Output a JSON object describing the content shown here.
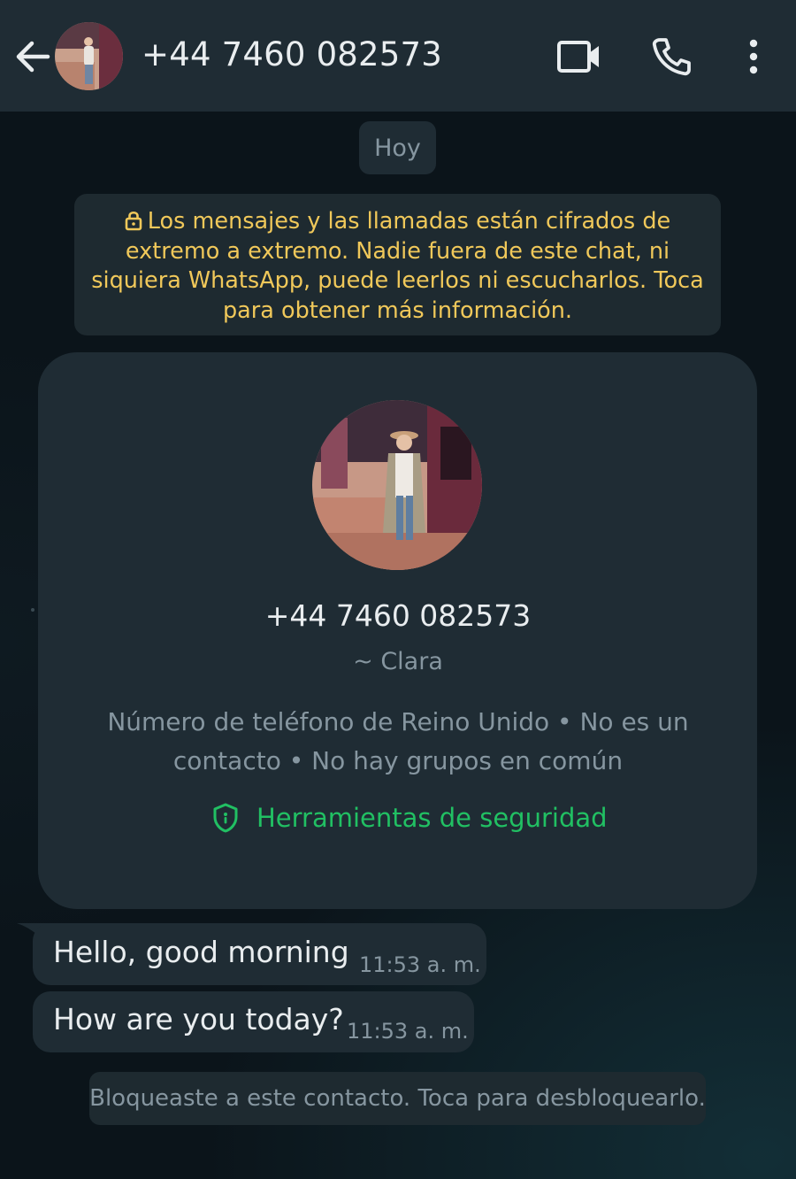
{
  "header": {
    "title": "+44 7460 082573",
    "back_icon": "arrow-left-icon",
    "video_icon": "video-camera-icon",
    "call_icon": "phone-icon",
    "more_icon": "more-vertical-icon"
  },
  "date_chip": "Hoy",
  "encryption_notice": {
    "icon": "lock-icon",
    "text": "Los mensajes y las llamadas están cifrados de extremo a extremo. Nadie fuera de este chat, ni siquiera WhatsApp, puede leerlos ni escucharlos. Toca para obtener más información."
  },
  "contact_card": {
    "phone": "+44 7460 082573",
    "name": "~ Clara",
    "info": "Número de teléfono de Reino Unido • No es un contacto • No hay grupos en común",
    "security_link": "Herramientas de seguridad",
    "security_icon": "shield-icon"
  },
  "messages": [
    {
      "text": "Hello, good morning",
      "time": "11:53 a. m."
    },
    {
      "text": "How are you today?",
      "time": "11:53 a. m."
    }
  ],
  "blocked_notice": "Bloqueaste a este contacto. Toca para desbloquearlo.",
  "colors": {
    "background": "#0b141a",
    "header": "#1f2c34",
    "bubble": "#1f2c34",
    "notice_text": "#f0c85a",
    "accent_green": "#21c063",
    "secondary_text": "#8696a0"
  }
}
